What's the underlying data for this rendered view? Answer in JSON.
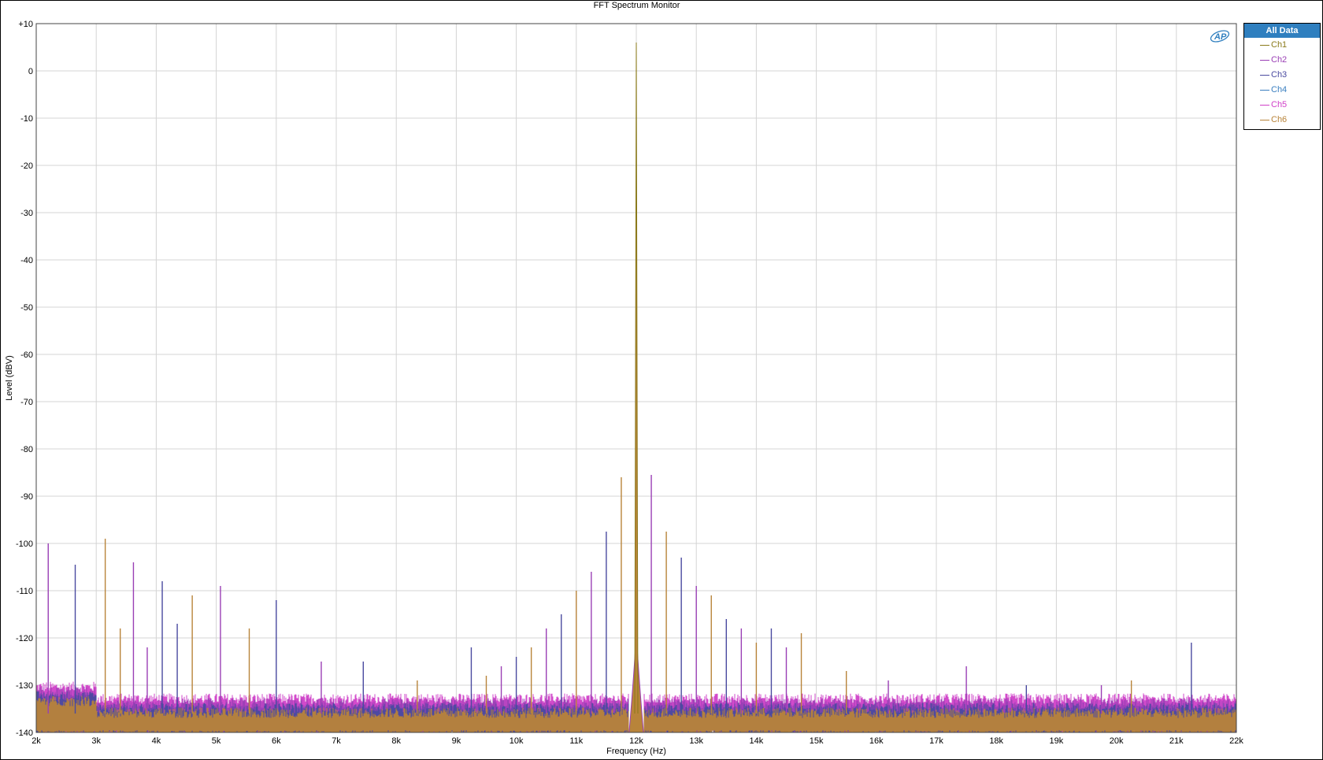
{
  "chart_data": {
    "type": "line",
    "title": "FFT Spectrum Monitor",
    "xlabel": "Frequency (Hz)",
    "ylabel": "Level (dBV)",
    "xlim": [
      2000,
      22000
    ],
    "ylim": [
      -140,
      10
    ],
    "x_ticks": [
      2000,
      3000,
      4000,
      5000,
      6000,
      7000,
      8000,
      9000,
      10000,
      11000,
      12000,
      13000,
      14000,
      15000,
      16000,
      17000,
      18000,
      19000,
      20000,
      21000,
      22000
    ],
    "x_tick_labels": [
      "2k",
      "3k",
      "4k",
      "5k",
      "6k",
      "7k",
      "8k",
      "9k",
      "10k",
      "11k",
      "12k",
      "13k",
      "14k",
      "15k",
      "16k",
      "17k",
      "18k",
      "19k",
      "20k",
      "21k",
      "22k"
    ],
    "y_ticks": [
      10,
      0,
      -10,
      -20,
      -30,
      -40,
      -50,
      -60,
      -70,
      -80,
      -90,
      -100,
      -110,
      -120,
      -130,
      -140
    ],
    "y_tick_labels": [
      "+10",
      "0",
      "-10",
      "-20",
      "-30",
      "-40",
      "-50",
      "-60",
      "-70",
      "-80",
      "-90",
      "-100",
      "-110",
      "-120",
      "-130",
      "-140"
    ],
    "grid": true,
    "legend_position": "right",
    "legend_title": "All Data",
    "noise_floor_db": -135,
    "series": [
      {
        "name": "Ch1",
        "color": "#8a7a1a"
      },
      {
        "name": "Ch2",
        "color": "#9a3fb5"
      },
      {
        "name": "Ch3",
        "color": "#4a4aa0"
      },
      {
        "name": "Ch4",
        "color": "#3a7fc0"
      },
      {
        "name": "Ch5",
        "color": "#d040c8"
      },
      {
        "name": "Ch6",
        "color": "#b8843a"
      }
    ],
    "fundamental": {
      "x": 12000,
      "y": 6
    },
    "peaks": [
      {
        "x": 11750,
        "y": -86
      },
      {
        "x": 12250,
        "y": -85.5
      },
      {
        "x": 11500,
        "y": -97.5
      },
      {
        "x": 12500,
        "y": -97.5
      },
      {
        "x": 11250,
        "y": -106
      },
      {
        "x": 12750,
        "y": -103
      },
      {
        "x": 11000,
        "y": -110
      },
      {
        "x": 13000,
        "y": -109
      },
      {
        "x": 10750,
        "y": -115
      },
      {
        "x": 13250,
        "y": -111
      },
      {
        "x": 10500,
        "y": -118
      },
      {
        "x": 13500,
        "y": -116
      },
      {
        "x": 10250,
        "y": -122
      },
      {
        "x": 13750,
        "y": -118
      },
      {
        "x": 10000,
        "y": -124
      },
      {
        "x": 14000,
        "y": -121
      },
      {
        "x": 9750,
        "y": -126
      },
      {
        "x": 14250,
        "y": -118
      },
      {
        "x": 9500,
        "y": -128
      },
      {
        "x": 14500,
        "y": -122
      },
      {
        "x": 9250,
        "y": -122
      },
      {
        "x": 14750,
        "y": -119
      },
      {
        "x": 2200,
        "y": -100
      },
      {
        "x": 2650,
        "y": -104.5
      },
      {
        "x": 3150,
        "y": -99
      },
      {
        "x": 3620,
        "y": -104
      },
      {
        "x": 4100,
        "y": -108
      },
      {
        "x": 4600,
        "y": -111
      },
      {
        "x": 5070,
        "y": -109
      },
      {
        "x": 6000,
        "y": -112
      },
      {
        "x": 3400,
        "y": -118
      },
      {
        "x": 3850,
        "y": -122
      },
      {
        "x": 4350,
        "y": -117
      },
      {
        "x": 5550,
        "y": -118
      },
      {
        "x": 6750,
        "y": -125
      },
      {
        "x": 7450,
        "y": -125
      },
      {
        "x": 8350,
        "y": -129
      },
      {
        "x": 17500,
        "y": -126
      },
      {
        "x": 21250,
        "y": -121
      },
      {
        "x": 20250,
        "y": -129
      },
      {
        "x": 19750,
        "y": -130
      },
      {
        "x": 18500,
        "y": -130
      },
      {
        "x": 15500,
        "y": -127
      },
      {
        "x": 16200,
        "y": -129
      }
    ]
  }
}
